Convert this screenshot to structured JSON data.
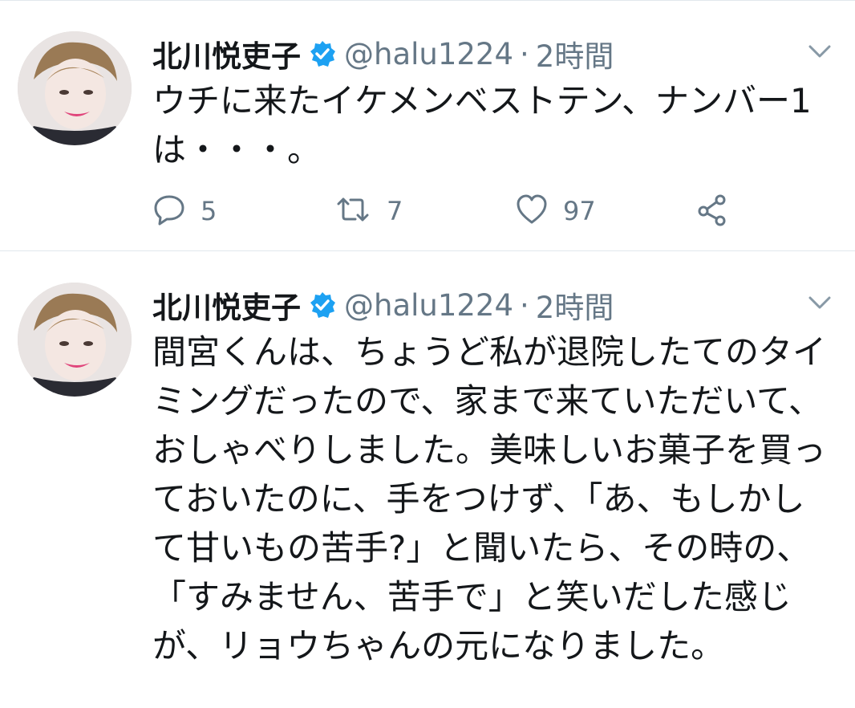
{
  "tweets": [
    {
      "name": "北川悦吏子",
      "handle": "@halu1224",
      "dot": "·",
      "time": "2時間",
      "text": "ウチに来たイケメンベストテン、ナンバー1は・・・。",
      "reply_count": "5",
      "retweet_count": "7",
      "like_count": "97"
    },
    {
      "name": "北川悦吏子",
      "handle": "@halu1224",
      "dot": "·",
      "time": "2時間",
      "text": "間宮くんは、ちょうど私が退院したてのタイミングだったので、家まで来ていただいて、おしゃべりしました。美味しいお菓子を買っておいたのに、手をつけず、「あ、もしかして甘いもの苦手?」と聞いたら、その時の、「すみません、苦手で」と笑いだした感じが、リョウちゃんの元になりました。"
    }
  ],
  "colors": {
    "verified": "#1da1f2",
    "secondary_text": "#657786",
    "divider": "#e1e8ed"
  },
  "icons": [
    "verified-badge-icon",
    "chevron-down-icon",
    "reply-icon",
    "retweet-icon",
    "like-icon",
    "share-icon"
  ]
}
